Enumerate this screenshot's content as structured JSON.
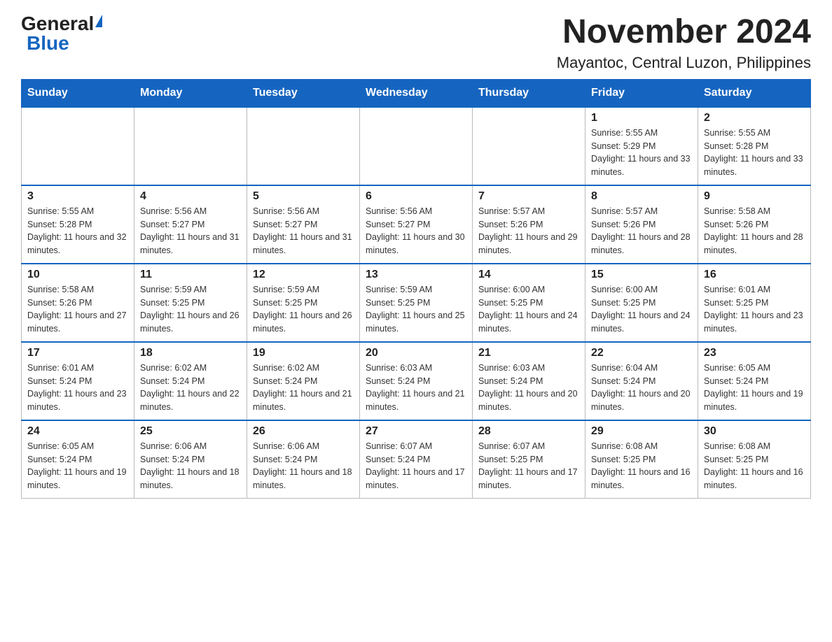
{
  "header": {
    "logo_general": "General",
    "logo_blue": "Blue",
    "title": "November 2024",
    "subtitle": "Mayantoc, Central Luzon, Philippines"
  },
  "calendar": {
    "days_of_week": [
      "Sunday",
      "Monday",
      "Tuesday",
      "Wednesday",
      "Thursday",
      "Friday",
      "Saturday"
    ],
    "weeks": [
      [
        {
          "day": "",
          "info": ""
        },
        {
          "day": "",
          "info": ""
        },
        {
          "day": "",
          "info": ""
        },
        {
          "day": "",
          "info": ""
        },
        {
          "day": "",
          "info": ""
        },
        {
          "day": "1",
          "info": "Sunrise: 5:55 AM\nSunset: 5:29 PM\nDaylight: 11 hours and 33 minutes."
        },
        {
          "day": "2",
          "info": "Sunrise: 5:55 AM\nSunset: 5:28 PM\nDaylight: 11 hours and 33 minutes."
        }
      ],
      [
        {
          "day": "3",
          "info": "Sunrise: 5:55 AM\nSunset: 5:28 PM\nDaylight: 11 hours and 32 minutes."
        },
        {
          "day": "4",
          "info": "Sunrise: 5:56 AM\nSunset: 5:27 PM\nDaylight: 11 hours and 31 minutes."
        },
        {
          "day": "5",
          "info": "Sunrise: 5:56 AM\nSunset: 5:27 PM\nDaylight: 11 hours and 31 minutes."
        },
        {
          "day": "6",
          "info": "Sunrise: 5:56 AM\nSunset: 5:27 PM\nDaylight: 11 hours and 30 minutes."
        },
        {
          "day": "7",
          "info": "Sunrise: 5:57 AM\nSunset: 5:26 PM\nDaylight: 11 hours and 29 minutes."
        },
        {
          "day": "8",
          "info": "Sunrise: 5:57 AM\nSunset: 5:26 PM\nDaylight: 11 hours and 28 minutes."
        },
        {
          "day": "9",
          "info": "Sunrise: 5:58 AM\nSunset: 5:26 PM\nDaylight: 11 hours and 28 minutes."
        }
      ],
      [
        {
          "day": "10",
          "info": "Sunrise: 5:58 AM\nSunset: 5:26 PM\nDaylight: 11 hours and 27 minutes."
        },
        {
          "day": "11",
          "info": "Sunrise: 5:59 AM\nSunset: 5:25 PM\nDaylight: 11 hours and 26 minutes."
        },
        {
          "day": "12",
          "info": "Sunrise: 5:59 AM\nSunset: 5:25 PM\nDaylight: 11 hours and 26 minutes."
        },
        {
          "day": "13",
          "info": "Sunrise: 5:59 AM\nSunset: 5:25 PM\nDaylight: 11 hours and 25 minutes."
        },
        {
          "day": "14",
          "info": "Sunrise: 6:00 AM\nSunset: 5:25 PM\nDaylight: 11 hours and 24 minutes."
        },
        {
          "day": "15",
          "info": "Sunrise: 6:00 AM\nSunset: 5:25 PM\nDaylight: 11 hours and 24 minutes."
        },
        {
          "day": "16",
          "info": "Sunrise: 6:01 AM\nSunset: 5:25 PM\nDaylight: 11 hours and 23 minutes."
        }
      ],
      [
        {
          "day": "17",
          "info": "Sunrise: 6:01 AM\nSunset: 5:24 PM\nDaylight: 11 hours and 23 minutes."
        },
        {
          "day": "18",
          "info": "Sunrise: 6:02 AM\nSunset: 5:24 PM\nDaylight: 11 hours and 22 minutes."
        },
        {
          "day": "19",
          "info": "Sunrise: 6:02 AM\nSunset: 5:24 PM\nDaylight: 11 hours and 21 minutes."
        },
        {
          "day": "20",
          "info": "Sunrise: 6:03 AM\nSunset: 5:24 PM\nDaylight: 11 hours and 21 minutes."
        },
        {
          "day": "21",
          "info": "Sunrise: 6:03 AM\nSunset: 5:24 PM\nDaylight: 11 hours and 20 minutes."
        },
        {
          "day": "22",
          "info": "Sunrise: 6:04 AM\nSunset: 5:24 PM\nDaylight: 11 hours and 20 minutes."
        },
        {
          "day": "23",
          "info": "Sunrise: 6:05 AM\nSunset: 5:24 PM\nDaylight: 11 hours and 19 minutes."
        }
      ],
      [
        {
          "day": "24",
          "info": "Sunrise: 6:05 AM\nSunset: 5:24 PM\nDaylight: 11 hours and 19 minutes."
        },
        {
          "day": "25",
          "info": "Sunrise: 6:06 AM\nSunset: 5:24 PM\nDaylight: 11 hours and 18 minutes."
        },
        {
          "day": "26",
          "info": "Sunrise: 6:06 AM\nSunset: 5:24 PM\nDaylight: 11 hours and 18 minutes."
        },
        {
          "day": "27",
          "info": "Sunrise: 6:07 AM\nSunset: 5:24 PM\nDaylight: 11 hours and 17 minutes."
        },
        {
          "day": "28",
          "info": "Sunrise: 6:07 AM\nSunset: 5:25 PM\nDaylight: 11 hours and 17 minutes."
        },
        {
          "day": "29",
          "info": "Sunrise: 6:08 AM\nSunset: 5:25 PM\nDaylight: 11 hours and 16 minutes."
        },
        {
          "day": "30",
          "info": "Sunrise: 6:08 AM\nSunset: 5:25 PM\nDaylight: 11 hours and 16 minutes."
        }
      ]
    ]
  }
}
